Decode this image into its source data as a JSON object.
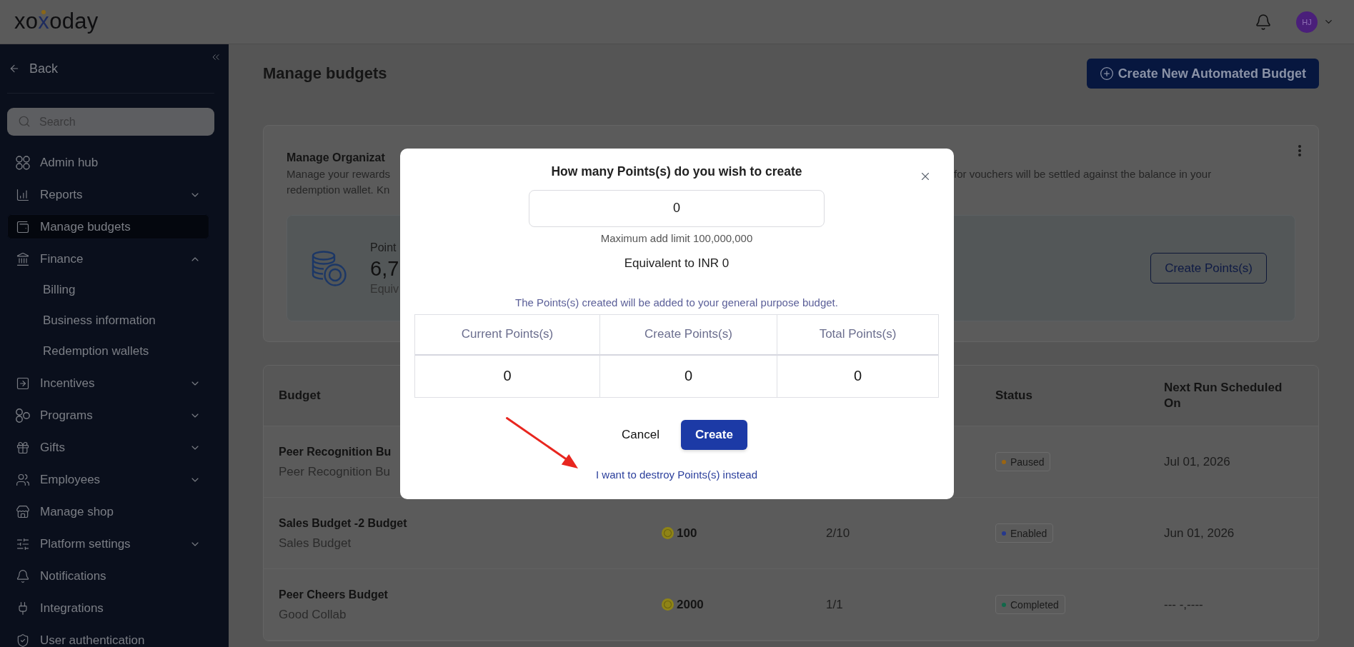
{
  "header": {
    "logo": "xoxoday",
    "avatar": "HJ"
  },
  "sidebar": {
    "back": "Back",
    "search": {
      "placeholder": "Search"
    },
    "items": [
      {
        "kind": "link",
        "label": "Admin hub",
        "selected": false
      },
      {
        "kind": "group",
        "label": "Reports",
        "selected": false,
        "expanded": false
      },
      {
        "kind": "link",
        "label": "Manage budgets",
        "selected": true
      },
      {
        "kind": "group",
        "label": "Finance",
        "selected": false,
        "expanded": true,
        "children": [
          {
            "label": "Billing",
            "selected": false
          },
          {
            "label": "Business information",
            "selected": false
          },
          {
            "label": "Redemption wallets",
            "selected": false
          }
        ]
      },
      {
        "kind": "group",
        "label": "Incentives",
        "selected": false,
        "expanded": false
      },
      {
        "kind": "group",
        "label": "Programs",
        "selected": false,
        "expanded": false
      },
      {
        "kind": "group",
        "label": "Gifts",
        "selected": false,
        "expanded": false
      },
      {
        "kind": "group",
        "label": "Employees",
        "selected": false,
        "expanded": false
      },
      {
        "kind": "link",
        "label": "Manage shop",
        "selected": false
      },
      {
        "kind": "group",
        "label": "Platform settings",
        "selected": false,
        "expanded": false
      },
      {
        "kind": "link",
        "label": "Notifications",
        "selected": false
      },
      {
        "kind": "link",
        "label": "Integrations",
        "selected": false
      },
      {
        "kind": "link",
        "label": "User authentication",
        "selected": false
      }
    ]
  },
  "page": {
    "title": "Manage budgets",
    "create_button": "Create New Automated Budget"
  },
  "org_card": {
    "title": "Manage Organizat",
    "description_left": [
      "Manage your rewards",
      "redemption wallet. Kn"
    ],
    "description_right": "for vouchers will be settled against the balance in your",
    "points_label": "Point",
    "points_value": "6,7",
    "points_equivalent": "Equiv",
    "button": "Create Points(s)"
  },
  "budgets_table": {
    "header": {
      "budget": "Budget",
      "status": "Status",
      "next_run": "Next Run Scheduled On"
    },
    "rows": [
      {
        "name": "Peer Recognition Bu",
        "program": "Peer Recognition Bu",
        "status": {
          "label": "Paused",
          "color": "#9a6512"
        },
        "next_run": "Jul 01, 2026"
      },
      {
        "name": "Sales Budget -2 Budget",
        "program": "Sales Budget",
        "amount": "100",
        "usage": "2/10",
        "status": {
          "label": "Enabled",
          "color": "#26388c"
        },
        "next_run": "Jun 01, 2026"
      },
      {
        "name": "Peer Cheers Budget",
        "program": "Good Collab",
        "amount": "2000",
        "usage": "1/1",
        "status": {
          "label": "Completed",
          "color": "#12684a"
        },
        "next_run": "--- -,----"
      }
    ]
  },
  "modal": {
    "title": "How many Points(s) do you wish to create",
    "input": {
      "value": "0"
    },
    "limit_note": "Maximum add limit 100,000,000",
    "equivalent": "Equivalent to INR 0",
    "info": "The Points(s) created will be added to your general purpose budget.",
    "summary": {
      "columns": [
        "Current Points(s)",
        "Create Points(s)",
        "Total Points(s)"
      ],
      "values": [
        "0",
        "0",
        "0"
      ]
    },
    "cancel_button": "Cancel",
    "create_button": "Create",
    "destroy_link": "I want to destroy Points(s) instead"
  }
}
